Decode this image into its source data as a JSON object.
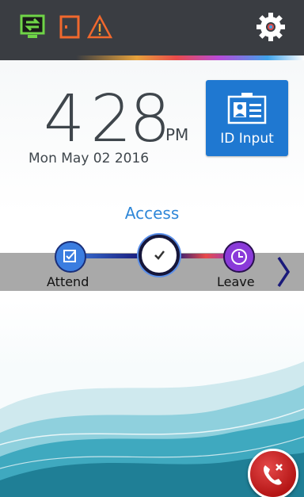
{
  "status_bar": {
    "icons": [
      "network-sync-icon",
      "door-icon",
      "warning-icon"
    ],
    "settings_icon": "gear-icon"
  },
  "clock": {
    "hours": "4",
    "minutes": "28",
    "ampm": "PM",
    "date": "Mon May 02 2016"
  },
  "id_input": {
    "label": "ID Input",
    "icon": "id-card-icon"
  },
  "mode_selector": {
    "title": "Access",
    "items": [
      {
        "label": "Attend",
        "icon": "edit-check-icon"
      },
      {
        "label": "",
        "icon": "check-icon",
        "selected": true
      },
      {
        "label": "Leave",
        "icon": "clock-icon"
      }
    ],
    "next_icon": "chevron-right-icon"
  },
  "end_call": {
    "icon": "phone-cancel-icon"
  },
  "colors": {
    "topbar": "#3a3d42",
    "accent_blue": "#1f78d1",
    "access_text": "#2f87d8",
    "band": "#a9a9a9",
    "end_call": "#c81e1e"
  }
}
